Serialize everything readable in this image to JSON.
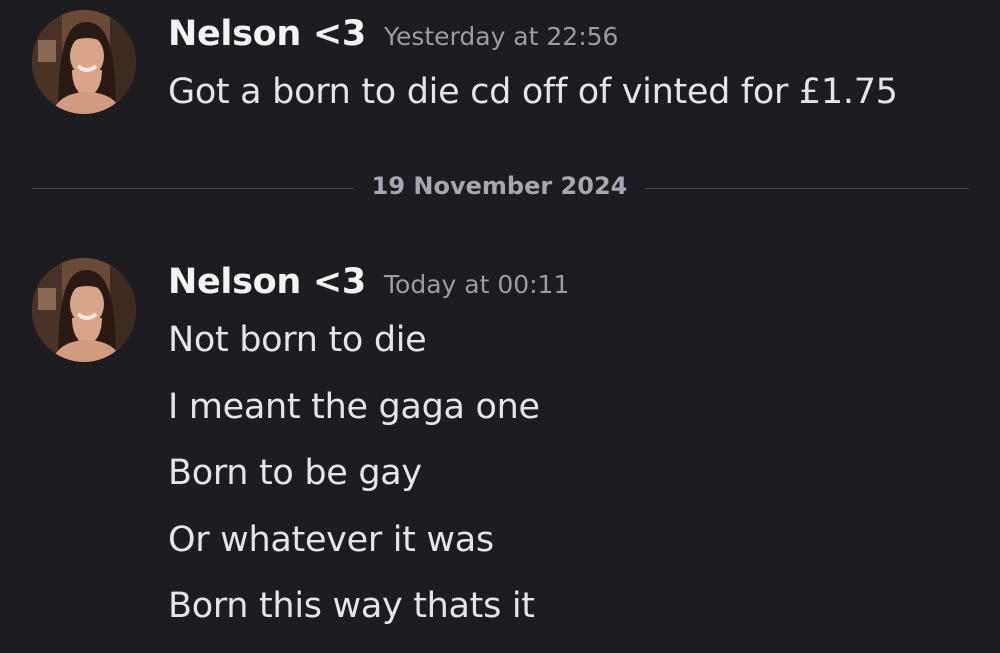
{
  "colors": {
    "background": "#1c1c21",
    "username": "#f2f3f5",
    "timestamp": "#9a9ca6",
    "message_text": "#e4e5e9",
    "divider": "#44464f"
  },
  "messages": [
    {
      "username": "Nelson <3",
      "timestamp": "Yesterday at 22:56",
      "avatar_icon": "user-avatar-icon",
      "lines": [
        "Got a born to die cd off of vinted for £1.75"
      ]
    },
    {
      "username": "Nelson <3",
      "timestamp": "Today at 00:11",
      "avatar_icon": "user-avatar-icon",
      "lines": [
        "Not born to die",
        "I meant the gaga one",
        "Born to be gay",
        "Or whatever it was",
        "Born this way thats it"
      ]
    }
  ],
  "date_divider": {
    "label": "19 November 2024"
  }
}
